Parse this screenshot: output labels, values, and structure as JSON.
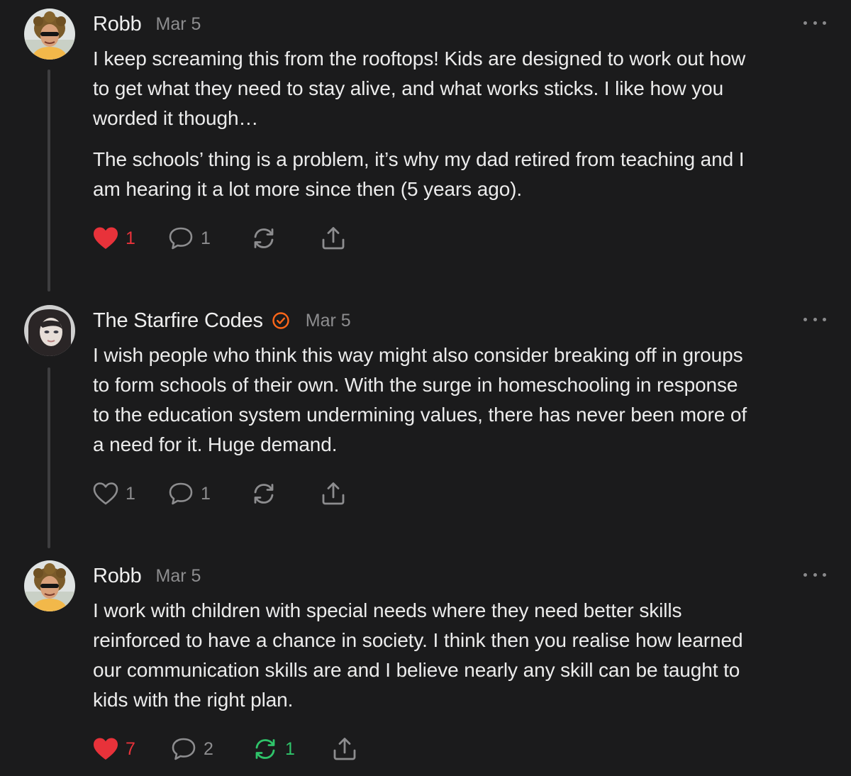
{
  "comments": [
    {
      "author": "Robb",
      "date": "Mar 5",
      "paragraphs": [
        [
          "I keep screaming this from the rooftops! Kids are designed to work out how",
          "to get what they need to stay alive, and what works sticks. I like how you",
          "worded it though…"
        ],
        [
          "The schools’ thing is a problem, it’s why my dad retired from teaching and I",
          "am hearing it a lot more since then (5 years ago)."
        ]
      ],
      "likes": "1",
      "liked": true,
      "replies": "1",
      "restacks": "",
      "restacked": false
    },
    {
      "author": "The Starfire Codes",
      "date": "Mar 5",
      "verified": true,
      "paragraphs": [
        [
          "I wish people who think this way might also consider breaking off in groups",
          "to form schools of their own. With the surge in homeschooling in response",
          "to the education system undermining values, there has never been more of",
          "a need for it. Huge demand."
        ]
      ],
      "likes": "1",
      "liked": false,
      "replies": "1",
      "restacks": "",
      "restacked": false
    },
    {
      "author": "Robb",
      "date": "Mar 5",
      "paragraphs": [
        [
          "I work with children with special needs where they need better skills",
          "reinforced to have a chance in society. I think then you realise how learned",
          "our communication skills are and I believe nearly any skill can be taught to",
          "kids with the right plan."
        ]
      ],
      "likes": "7",
      "liked": true,
      "replies": "2",
      "restacks": "1",
      "restacked": true
    }
  ],
  "colors": {
    "background": "#1b1b1c",
    "text": "#ececec",
    "muted": "#8d8d8f",
    "like_red": "#e8323a",
    "restack_green": "#2fc46a",
    "verified_orange": "#ff6719"
  },
  "icons": [
    "heart-icon",
    "comment-bubble-icon",
    "restack-icon",
    "share-upload-icon",
    "more-dots-icon",
    "verified-check-icon"
  ]
}
